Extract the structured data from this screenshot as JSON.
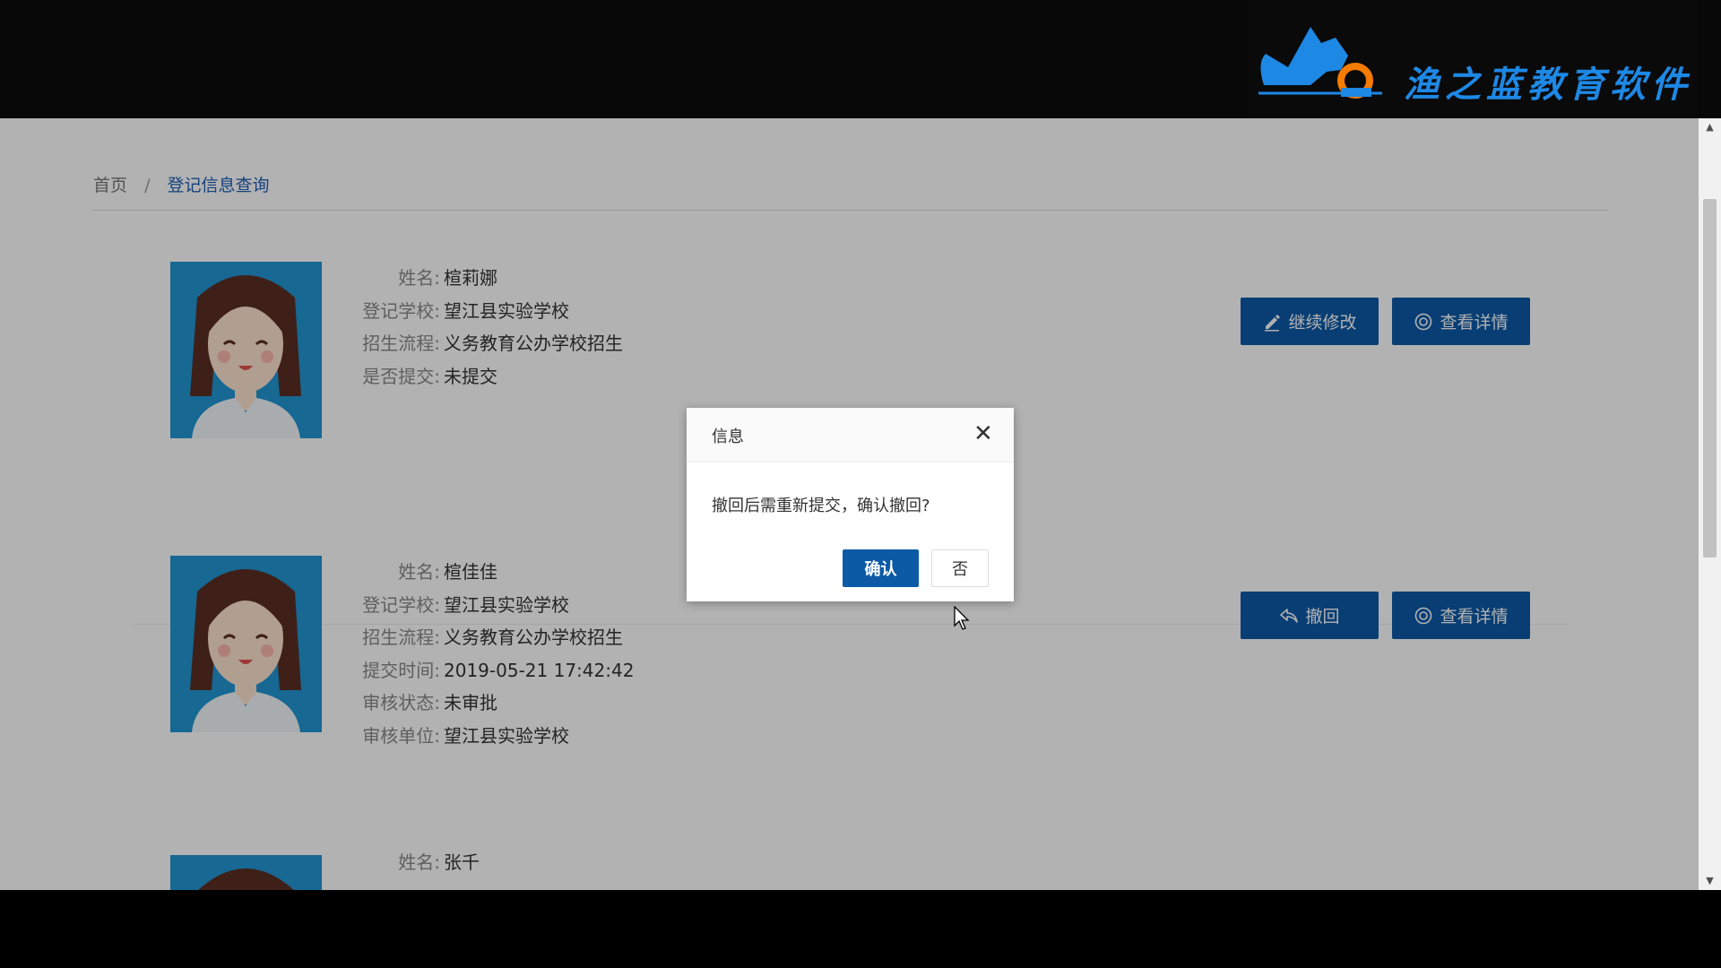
{
  "header": {
    "logo_text": "渔之蓝教育软件"
  },
  "breadcrumb": {
    "home": "首页",
    "separator": "/",
    "current": "登记信息查询"
  },
  "records": [
    {
      "fields": [
        {
          "label": "姓名:",
          "value": "楦莉娜"
        },
        {
          "label": "登记学校:",
          "value": "望江县实验学校"
        },
        {
          "label": "招生流程:",
          "value": "义务教育公办学校招生"
        },
        {
          "label": "是否提交:",
          "value": "未提交"
        }
      ],
      "buttons": [
        {
          "label": "继续修改",
          "icon": "edit-icon"
        },
        {
          "label": "查看详情",
          "icon": "eye-icon"
        }
      ]
    },
    {
      "fields": [
        {
          "label": "姓名:",
          "value": "楦佳佳"
        },
        {
          "label": "登记学校:",
          "value": "望江县实验学校"
        },
        {
          "label": "招生流程:",
          "value": "义务教育公办学校招生"
        },
        {
          "label": "提交时间:",
          "value": "2019-05-21 17:42:42"
        },
        {
          "label": "审核状态:",
          "value": "未审批"
        },
        {
          "label": "审核单位:",
          "value": "望江县实验学校"
        }
      ],
      "buttons": [
        {
          "label": "撤回",
          "icon": "undo-icon"
        },
        {
          "label": "查看详情",
          "icon": "eye-icon"
        }
      ]
    },
    {
      "fields": [
        {
          "label": "姓名:",
          "value": "张千"
        }
      ]
    }
  ],
  "dialog": {
    "title": "信息",
    "message": "撤回后需重新提交，确认撤回?",
    "confirm_label": "确认",
    "cancel_label": "否"
  },
  "colors": {
    "primary": "#0c5aa6",
    "photo_bg": "#2196d3",
    "logo_blue": "#1e88e5"
  }
}
